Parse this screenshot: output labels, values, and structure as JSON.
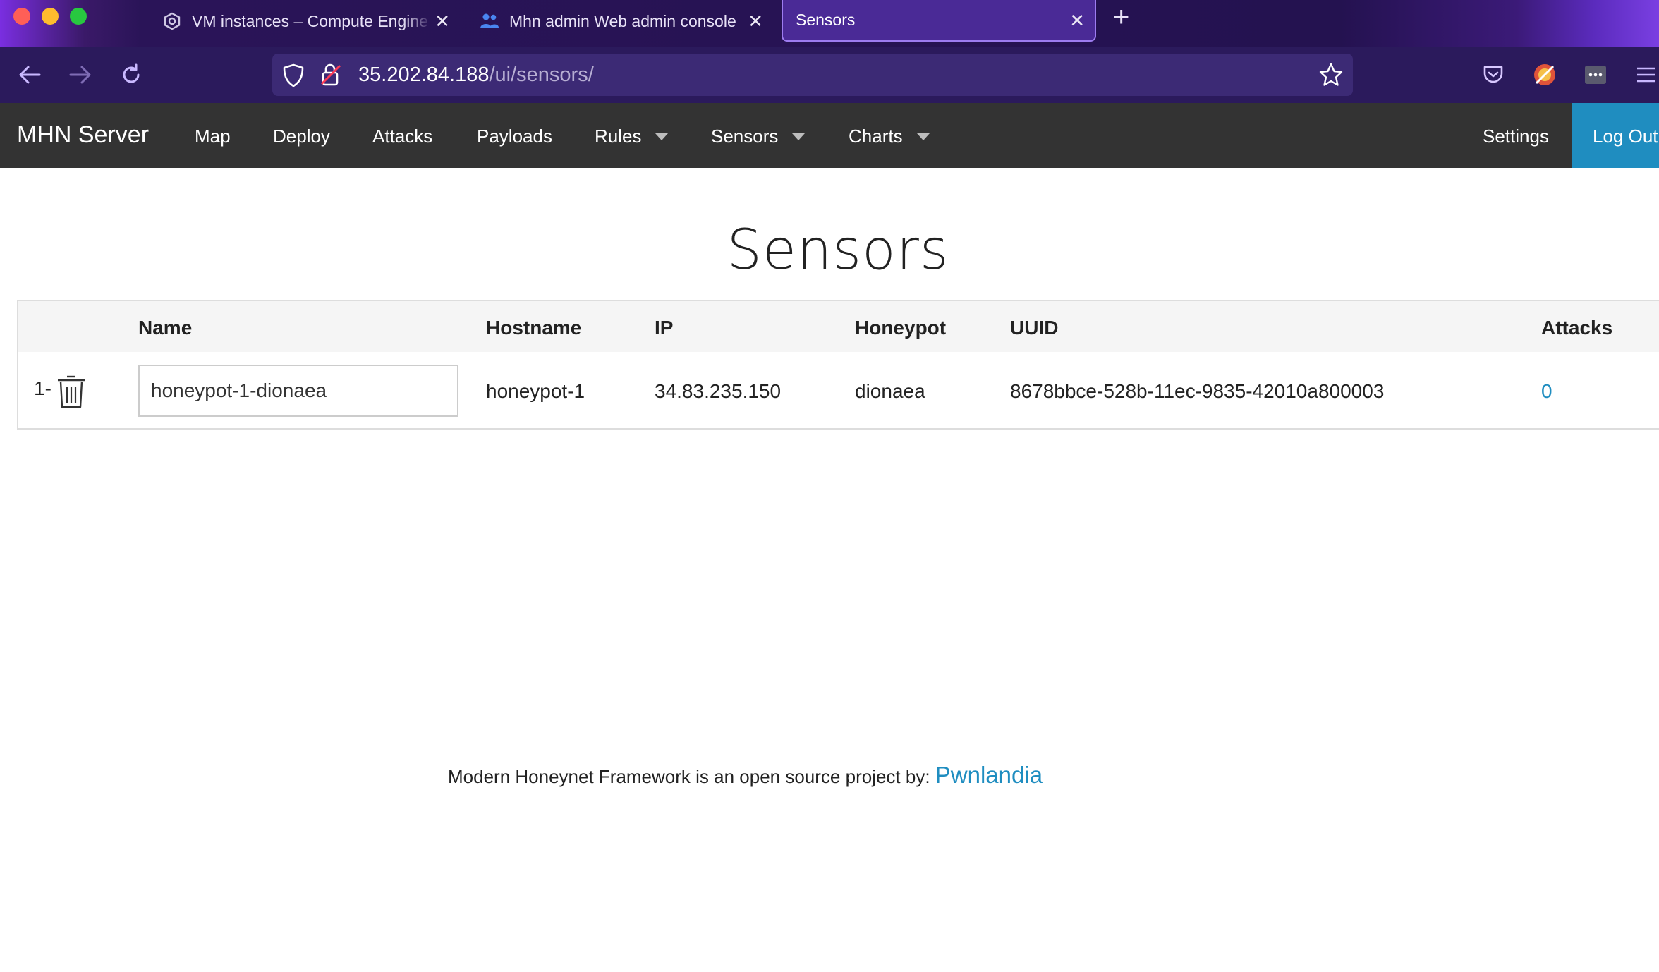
{
  "browser": {
    "tabs": [
      {
        "title": "VM instances – Compute Engine",
        "icon": "compute-engine-icon",
        "active": false
      },
      {
        "title": "Mhn admin Web admin console",
        "icon": "people-icon",
        "active": false
      },
      {
        "title": "Sensors",
        "icon": "",
        "active": true
      }
    ],
    "url_host": "35.202.84.188",
    "url_path": "/ui/sensors/",
    "colors": {
      "chrome_bg": "#2b1a5c",
      "active_tab": "#4a2a96"
    }
  },
  "navbar": {
    "brand": "MHN Server",
    "links": [
      "Map",
      "Deploy",
      "Attacks",
      "Payloads"
    ],
    "dropdowns": [
      "Rules",
      "Sensors",
      "Charts"
    ],
    "settings": "Settings",
    "logout": "Log Out",
    "colors": {
      "bg": "#333333",
      "logout_bg": "#1f8dc0"
    }
  },
  "page": {
    "title": "Sensors"
  },
  "table": {
    "headers": [
      "Name",
      "Hostname",
      "IP",
      "Honeypot",
      "UUID",
      "Attacks"
    ],
    "rows": [
      {
        "index": "1-",
        "name": "honeypot-1-dionaea",
        "hostname": "honeypot-1",
        "ip": "34.83.235.150",
        "honeypot": "dionaea",
        "uuid": "8678bbce-528b-11ec-9835-42010a800003",
        "attacks": "0"
      }
    ]
  },
  "footer": {
    "text": "Modern Honeynet Framework is an open source project by: ",
    "link": "Pwnlandia",
    "link_color": "#1f8dc0"
  }
}
